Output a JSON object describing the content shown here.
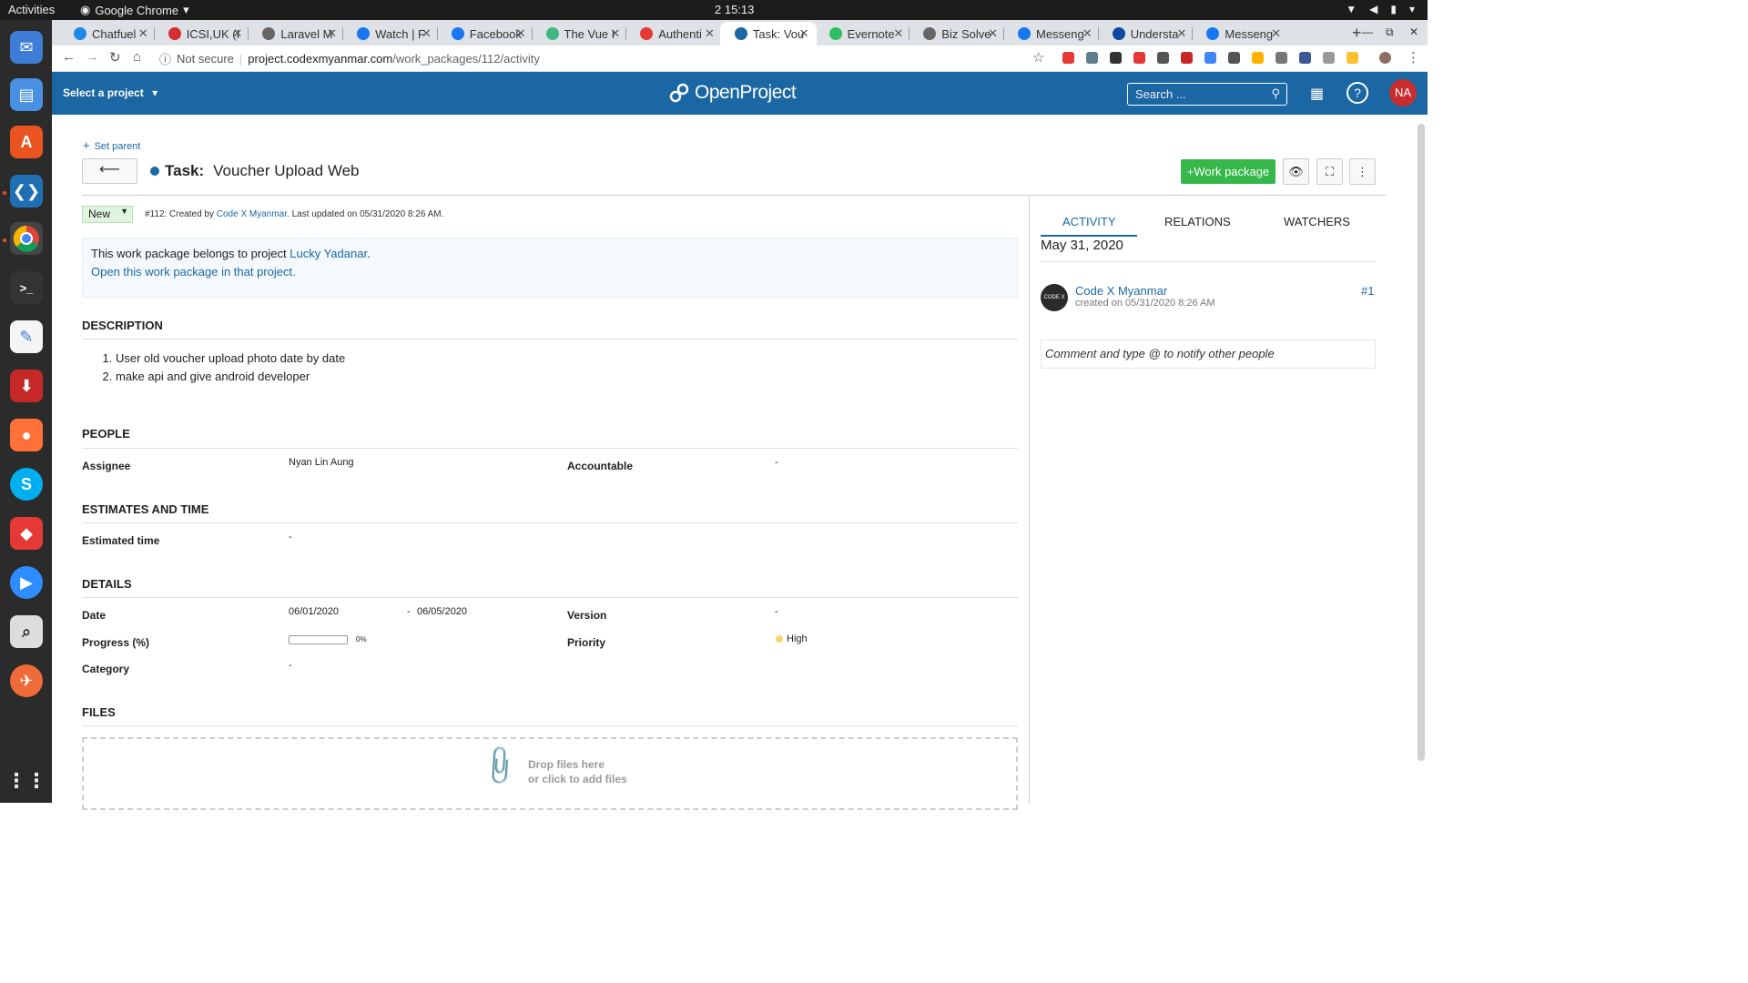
{
  "os": {
    "activities": "Activities",
    "app_name": "Google Chrome",
    "clock": "2  15:13"
  },
  "browser": {
    "tabs": [
      {
        "title": "Chatfuel",
        "icon_color": "#1e88e5"
      },
      {
        "title": "ICSI,UK (I",
        "icon_color": "#d32f2f"
      },
      {
        "title": "Laravel M",
        "icon_color": "#666666"
      },
      {
        "title": "Watch | F",
        "icon_color": "#1877f2"
      },
      {
        "title": "Facebook",
        "icon_color": "#1877f2"
      },
      {
        "title": "The Vue I",
        "icon_color": "#41b883"
      },
      {
        "title": "Authenti",
        "icon_color": "#e53935"
      },
      {
        "title": "Task: Vou",
        "icon_color": "#1a67a3"
      },
      {
        "title": "Evernote",
        "icon_color": "#2dbe60"
      },
      {
        "title": "Biz Solve",
        "icon_color": "#666666"
      },
      {
        "title": "Messeng",
        "icon_color": "#1877f2"
      },
      {
        "title": "Understa",
        "icon_color": "#0d47a1"
      },
      {
        "title": "Messeng",
        "icon_color": "#1877f2"
      }
    ],
    "active_tab_index": 7,
    "url_security": "Not secure",
    "url_host": "project.codexmyanmar.com",
    "url_path": "/work_packages/112/activity"
  },
  "header": {
    "select_project": "Select a project",
    "logo_text": "OpenProject",
    "search_placeholder": "Search ...",
    "avatar_initials": "NA",
    "brand_color": "#1a67a3"
  },
  "work_package": {
    "set_parent": "Set parent",
    "type": "Task:",
    "subject": "Voucher Upload Web",
    "add_button": "Work package",
    "status": "New",
    "meta_prefix": "#112: Created by",
    "meta_author": "Code X Myanmar",
    "meta_suffix": ". Last updated on 05/31/2020 8:26 AM.",
    "notice_line1_prefix": "This work package belongs to project",
    "notice_project": "Lucky Yadanar",
    "notice_line1_suffix": ".",
    "notice_line2": "Open this work package in that project.",
    "sections": {
      "description": "DESCRIPTION",
      "people": "PEOPLE",
      "estimates": "ESTIMATES AND TIME",
      "details": "DETAILS",
      "files": "FILES"
    },
    "description_items": [
      "User old voucher upload photo date by date",
      "make api and give android developer"
    ],
    "attributes": {
      "assignee_label": "Assignee",
      "assignee_value": "Nyan Lin Aung",
      "accountable_label": "Accountable",
      "accountable_value": "-",
      "estimated_label": "Estimated time",
      "estimated_value": "-",
      "date_label": "Date",
      "start_date": "06/01/2020",
      "date_sep": "-",
      "end_date": "06/05/2020",
      "version_label": "Version",
      "version_value": "-",
      "progress_label": "Progress (%)",
      "progress_text": "0%",
      "progress_value": 0,
      "priority_label": "Priority",
      "priority_value": "High",
      "category_label": "Category",
      "category_value": "-"
    },
    "drop_line1": "Drop files here",
    "drop_line2": "or click to add files"
  },
  "activity_pane": {
    "tabs": [
      "ACTIVITY",
      "RELATIONS",
      "WATCHERS"
    ],
    "date": "May 31, 2020",
    "user": "Code X Myanmar",
    "created": "created on 05/31/2020 8:26 AM",
    "number": "#1",
    "avatar_text": "CODE X",
    "comment_placeholder": "Comment and type @ to notify other people"
  }
}
